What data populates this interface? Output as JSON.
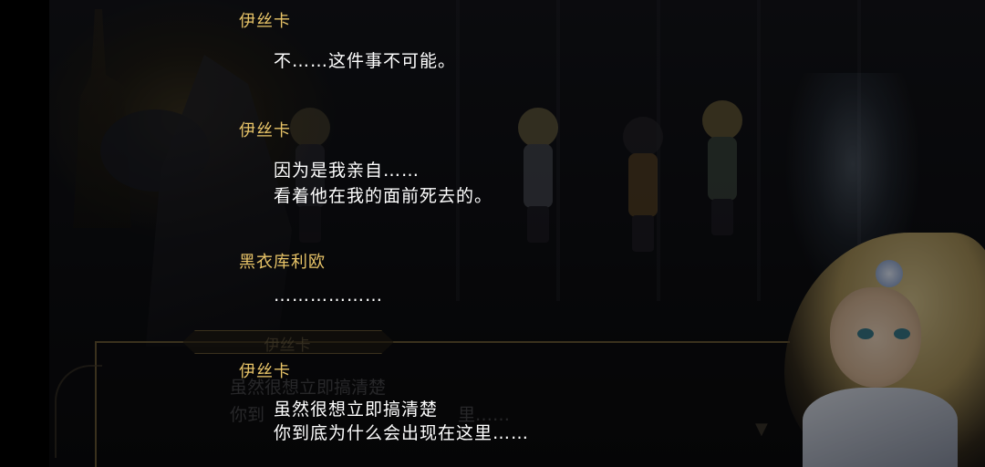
{
  "backlog": [
    {
      "speaker": "伊丝卡",
      "lines": [
        "不……这件事不可能。"
      ]
    },
    {
      "speaker": "伊丝卡",
      "lines": [
        "因为是我亲自……",
        "看着他在我的面前死去的。"
      ]
    },
    {
      "speaker": "黑衣库利欧",
      "lines": [
        "………………"
      ]
    },
    {
      "speaker": "伊丝卡",
      "lines": [
        "虽然很想立即搞清楚",
        "你到底为什么会出现在这里……"
      ]
    }
  ],
  "background_dialog": {
    "speaker": "伊丝卡",
    "line1": "虽然很想立即搞清楚",
    "line2": "你到",
    "line2_tail": "里……"
  },
  "colors": {
    "speaker": "#e8c468",
    "text": "#ffffff",
    "frame": "#6a5a36"
  }
}
